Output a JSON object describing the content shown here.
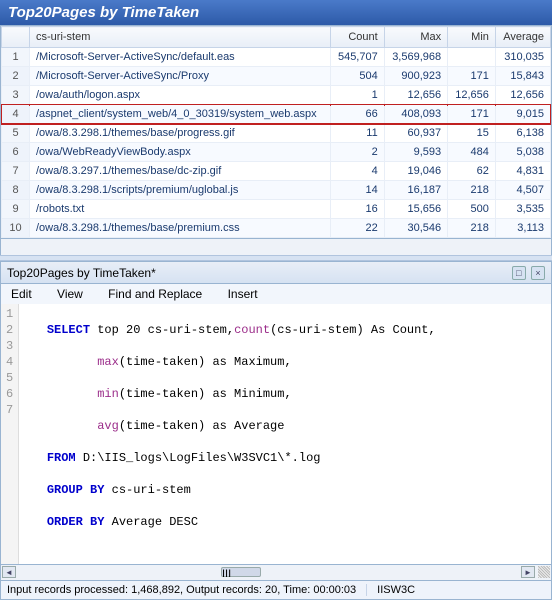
{
  "title": "Top20Pages by TimeTaken",
  "columns": {
    "rownum": "",
    "stem": "cs-uri-stem",
    "count": "Count",
    "max": "Max",
    "min": "Min",
    "avg": "Average"
  },
  "rows": [
    {
      "n": "1",
      "stem": "/Microsoft-Server-ActiveSync/default.eas",
      "count": "545,707",
      "max": "3,569,968",
      "min": "",
      "avg": "310,035",
      "hl": false
    },
    {
      "n": "2",
      "stem": "/Microsoft-Server-ActiveSync/Proxy",
      "count": "504",
      "max": "900,923",
      "min": "171",
      "avg": "15,843",
      "hl": false
    },
    {
      "n": "3",
      "stem": "/owa/auth/logon.aspx",
      "count": "1",
      "max": "12,656",
      "min": "12,656",
      "avg": "12,656",
      "hl": false
    },
    {
      "n": "4",
      "stem": "/aspnet_client/system_web/4_0_30319/system_web.aspx",
      "count": "66",
      "max": "408,093",
      "min": "171",
      "avg": "9,015",
      "hl": true
    },
    {
      "n": "5",
      "stem": "/owa/8.3.298.1/themes/base/progress.gif",
      "count": "11",
      "max": "60,937",
      "min": "15",
      "avg": "6,138",
      "hl": false
    },
    {
      "n": "6",
      "stem": "/owa/WebReadyViewBody.aspx",
      "count": "2",
      "max": "9,593",
      "min": "484",
      "avg": "5,038",
      "hl": false
    },
    {
      "n": "7",
      "stem": "/owa/8.3.297.1/themes/base/dc-zip.gif",
      "count": "4",
      "max": "19,046",
      "min": "62",
      "avg": "4,831",
      "hl": false
    },
    {
      "n": "8",
      "stem": "/owa/8.3.298.1/scripts/premium/uglobal.js",
      "count": "14",
      "max": "16,187",
      "min": "218",
      "avg": "4,507",
      "hl": false
    },
    {
      "n": "9",
      "stem": "/robots.txt",
      "count": "16",
      "max": "15,656",
      "min": "500",
      "avg": "3,535",
      "hl": false
    },
    {
      "n": "10",
      "stem": "/owa/8.3.298.1/themes/base/premium.css",
      "count": "22",
      "max": "30,546",
      "min": "218",
      "avg": "3,113",
      "hl": false
    }
  ],
  "subpanel": {
    "title": "Top20Pages by TimeTaken*",
    "menu": [
      "Edit",
      "View",
      "Find and Replace",
      "Insert"
    ]
  },
  "sql": {
    "l1a": "SELECT",
    "l1b": " top 20 cs-uri-stem,",
    "l1c": "count",
    "l1d": "(cs-uri-stem) As Count,",
    "l2a": "max",
    "l2b": "(time-taken) as Maximum,",
    "l3a": "min",
    "l3b": "(time-taken) as Minimum,",
    "l4a": "avg",
    "l4b": "(time-taken) as Average",
    "l5a": "FROM",
    "l5b": " D:\\IIS_logs\\LogFiles\\W3SVC1\\*.log",
    "l6a": "GROUP BY",
    "l6b": " cs-uri-stem",
    "l7a": "ORDER BY",
    "l7b": " Average DESC",
    "nums": [
      "1",
      "2",
      "3",
      "4",
      "5",
      "6",
      "7"
    ]
  },
  "scroll_thumb": "III",
  "status": {
    "main": "Input records processed: 1,468,892, Output records: 20, Time: 00:00:03",
    "mode": "IISW3C"
  }
}
